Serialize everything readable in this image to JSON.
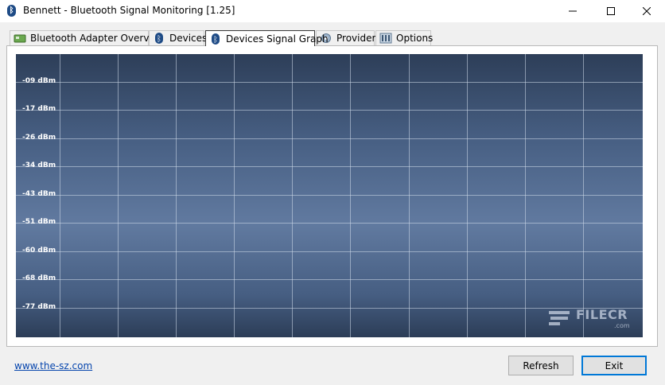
{
  "window": {
    "title": "Bennett - Bluetooth Signal Monitoring [1.25]",
    "app_icon": "bluetooth-icon"
  },
  "tabs": [
    {
      "label": "Bluetooth Adapter Overview",
      "icon": "adapter-icon",
      "active": false
    },
    {
      "label": "Devices",
      "icon": "bluetooth-icon",
      "active": false
    },
    {
      "label": "Devices Signal Graph",
      "icon": "bluetooth-icon",
      "active": true
    },
    {
      "label": "Provider",
      "icon": "gear-icon",
      "active": false
    },
    {
      "label": "Options",
      "icon": "options-icon",
      "active": false
    }
  ],
  "graph": {
    "y_labels": [
      "-09 dBm",
      "-17 dBm",
      "-26 dBm",
      "-34 dBm",
      "-43 dBm",
      "-51 dBm",
      "-60 dBm",
      "-68 dBm",
      "-77 dBm"
    ],
    "watermark": "FILECR",
    "watermark_sub": ".com",
    "background_colors": [
      "#2d3e58",
      "#617aa0"
    ]
  },
  "footer": {
    "link": "www.the-sz.com",
    "refresh_label": "Refresh",
    "exit_label": "Exit"
  }
}
